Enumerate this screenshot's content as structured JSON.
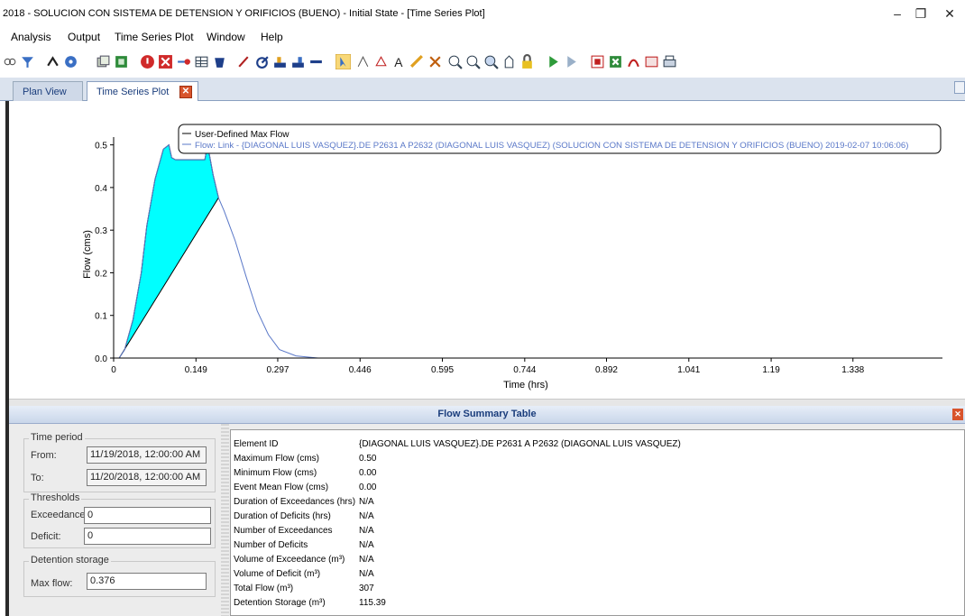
{
  "window": {
    "title": "2018 - SOLUCION CON SISTEMA DE DETENSION Y ORIFICIOS (BUENO) - Initial State - [Time Series Plot]",
    "minimize": "–",
    "restore": "❐",
    "close": "✕"
  },
  "menu": [
    "Analysis",
    "Output",
    "Time Series Plot",
    "Window",
    "Help"
  ],
  "tabs": [
    "Plan View",
    "Time Series Plot"
  ],
  "colors": {
    "fill": "#00ffff",
    "flow_line": "#5a78c8",
    "accent": "#1a3d7c",
    "close_red": "#d8542c"
  },
  "chart_data": {
    "type": "area",
    "xlabel": "Time (hrs)",
    "ylabel": "Flow (cms)",
    "xlim": [
      0,
      1.5
    ],
    "ylim": [
      0,
      0.55
    ],
    "x_ticks": [
      "0",
      "0.149",
      "0.297",
      "0.446",
      "0.595",
      "0.744",
      "0.892",
      "1.041",
      "1.19",
      "1.338"
    ],
    "x_tick_values": [
      0,
      0.149,
      0.297,
      0.446,
      0.595,
      0.744,
      0.892,
      1.041,
      1.19,
      1.338
    ],
    "y_ticks": [
      "0.0",
      "0.1",
      "0.2",
      "0.3",
      "0.4",
      "0.5"
    ],
    "y_tick_values": [
      0,
      0.1,
      0.2,
      0.3,
      0.4,
      0.5
    ],
    "legend": [
      "User-Defined Max Flow",
      "Flow: Link - {DIAGONAL LUIS VASQUEZ}.DE P2631 A P2632 (DIAGONAL LUIS VASQUEZ) (SOLUCION CON SISTEMA DE DETENSION Y ORIFICIOS (BUENO) 2019-02-07 10:06:06)"
    ],
    "legend_position": "top-right",
    "grid": false,
    "series": [
      {
        "name": "Flow: Link - {DIAGONAL LUIS VASQUEZ}.DE P2631 A P2632 (DIAGONAL LUIS VASQUEZ) (SOLUCION CON SISTEMA DE DETENSION Y ORIFICIOS (BUENO) 2019-02-07 10:06:06)",
        "x": [
          0.01,
          0.02,
          0.035,
          0.05,
          0.06,
          0.075,
          0.09,
          0.1,
          0.105,
          0.112,
          0.12,
          0.15,
          0.165,
          0.17,
          0.18,
          0.19,
          0.2,
          0.22,
          0.24,
          0.26,
          0.28,
          0.3,
          0.33,
          0.37,
          1.5
        ],
        "y": [
          0,
          0.02,
          0.09,
          0.2,
          0.31,
          0.42,
          0.49,
          0.5,
          0.47,
          0.465,
          0.465,
          0.465,
          0.465,
          0.5,
          0.43,
          0.375,
          0.345,
          0.275,
          0.19,
          0.11,
          0.055,
          0.02,
          0.005,
          0,
          0
        ]
      }
    ],
    "max_flow": 0.376
  },
  "summary": {
    "title": "Flow Summary Table",
    "time_period": {
      "label": "Time period",
      "from_label": "From:",
      "from": "11/19/2018, 12:00:00 AM",
      "to_label": "To:",
      "to": "11/20/2018, 12:00:00 AM"
    },
    "thresholds": {
      "label": "Thresholds",
      "exceedance_label": "Exceedance:",
      "exceedance": "0",
      "deficit_label": "Deficit:",
      "deficit": "0"
    },
    "detention": {
      "label": "Detention storage",
      "max_flow_label": "Max flow:",
      "max_flow": "0.376"
    },
    "rows": [
      {
        "k": "Element ID",
        "v": "{DIAGONAL LUIS VASQUEZ}.DE P2631 A P2632 (DIAGONAL LUIS VASQUEZ)"
      },
      {
        "k": "Maximum Flow (cms)",
        "v": "0.50"
      },
      {
        "k": "Minimum Flow (cms)",
        "v": "0.00"
      },
      {
        "k": "Event Mean Flow (cms)",
        "v": "0.00"
      },
      {
        "k": "Duration of Exceedances (hrs)",
        "v": "N/A"
      },
      {
        "k": "Duration of Deficits (hrs)",
        "v": "N/A"
      },
      {
        "k": "Number of Exceedances",
        "v": "N/A"
      },
      {
        "k": "Number of Deficits",
        "v": "N/A"
      },
      {
        "k": "Volume of Exceedance (m³)",
        "v": "N/A"
      },
      {
        "k": "Volume of Deficit (m³)",
        "v": "N/A"
      },
      {
        "k": "Total Flow (m³)",
        "v": "307"
      },
      {
        "k": "Detention Storage (m³)",
        "v": "115.39"
      }
    ]
  }
}
